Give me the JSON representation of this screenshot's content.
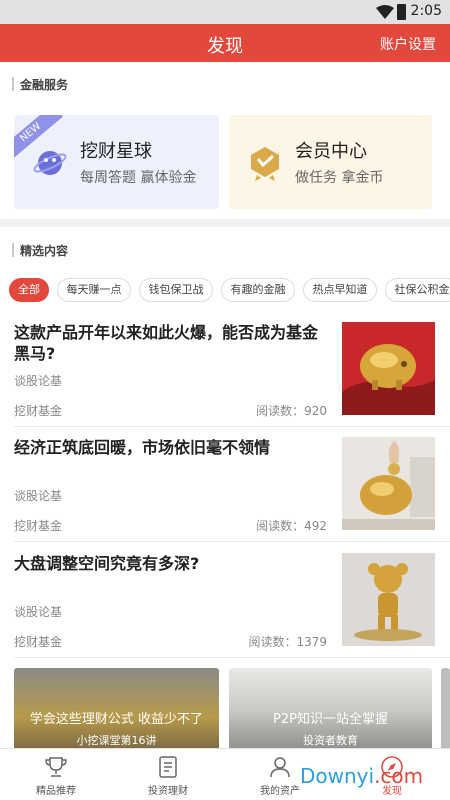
{
  "status_bar": {
    "time": "2:05"
  },
  "app_bar": {
    "title": "发现",
    "account_settings": "账户设置"
  },
  "financial_services": {
    "heading": "金融服务",
    "cards": [
      {
        "ribbon": "NEW",
        "title": "挖财星球",
        "subtitle": "每周答题 赢体验金",
        "icon": "planet-icon"
      },
      {
        "title": "会员中心",
        "subtitle": "做任务 拿金币",
        "icon": "member-badge-icon"
      }
    ]
  },
  "featured": {
    "heading": "精选内容",
    "chips": [
      "全部",
      "每天赚一点",
      "钱包保卫战",
      "有趣的金融",
      "热点早知道",
      "社保公积金"
    ],
    "active_chip": "全部",
    "articles": [
      {
        "title": "这款产品开年以来如此火爆，能否成为基金黑马?",
        "category": "谈股论基",
        "source": "挖财基金",
        "reads": "阅读数：920"
      },
      {
        "title": "经济正筑底回暖，市场依旧毫不领情",
        "category": "谈股论基",
        "source": "挖财基金",
        "reads": "阅读数：492"
      },
      {
        "title": "大盘调整空间究竟有多深?",
        "category": "谈股论基",
        "source": "挖财基金",
        "reads": "阅读数：1379"
      }
    ],
    "promos": [
      {
        "title": "学会这些理财公式 收益少不了",
        "subtitle": "小挖课堂第16讲"
      },
      {
        "title": "P2P知识一站全掌握",
        "subtitle": "投资者教育"
      }
    ]
  },
  "tab_bar": {
    "items": [
      {
        "label": "精品推荐",
        "icon": "trophy-icon"
      },
      {
        "label": "投资理财",
        "icon": "document-icon"
      },
      {
        "label": "我的资产",
        "icon": "user-icon"
      },
      {
        "label": "发现",
        "icon": "compass-icon"
      }
    ],
    "active": "发现"
  },
  "watermark": {
    "text": "Downyi",
    "suffix": ".com"
  },
  "colors": {
    "accent": "#e3483d",
    "card_blue": "#eef0fb",
    "card_gold": "#fdf5e6"
  }
}
